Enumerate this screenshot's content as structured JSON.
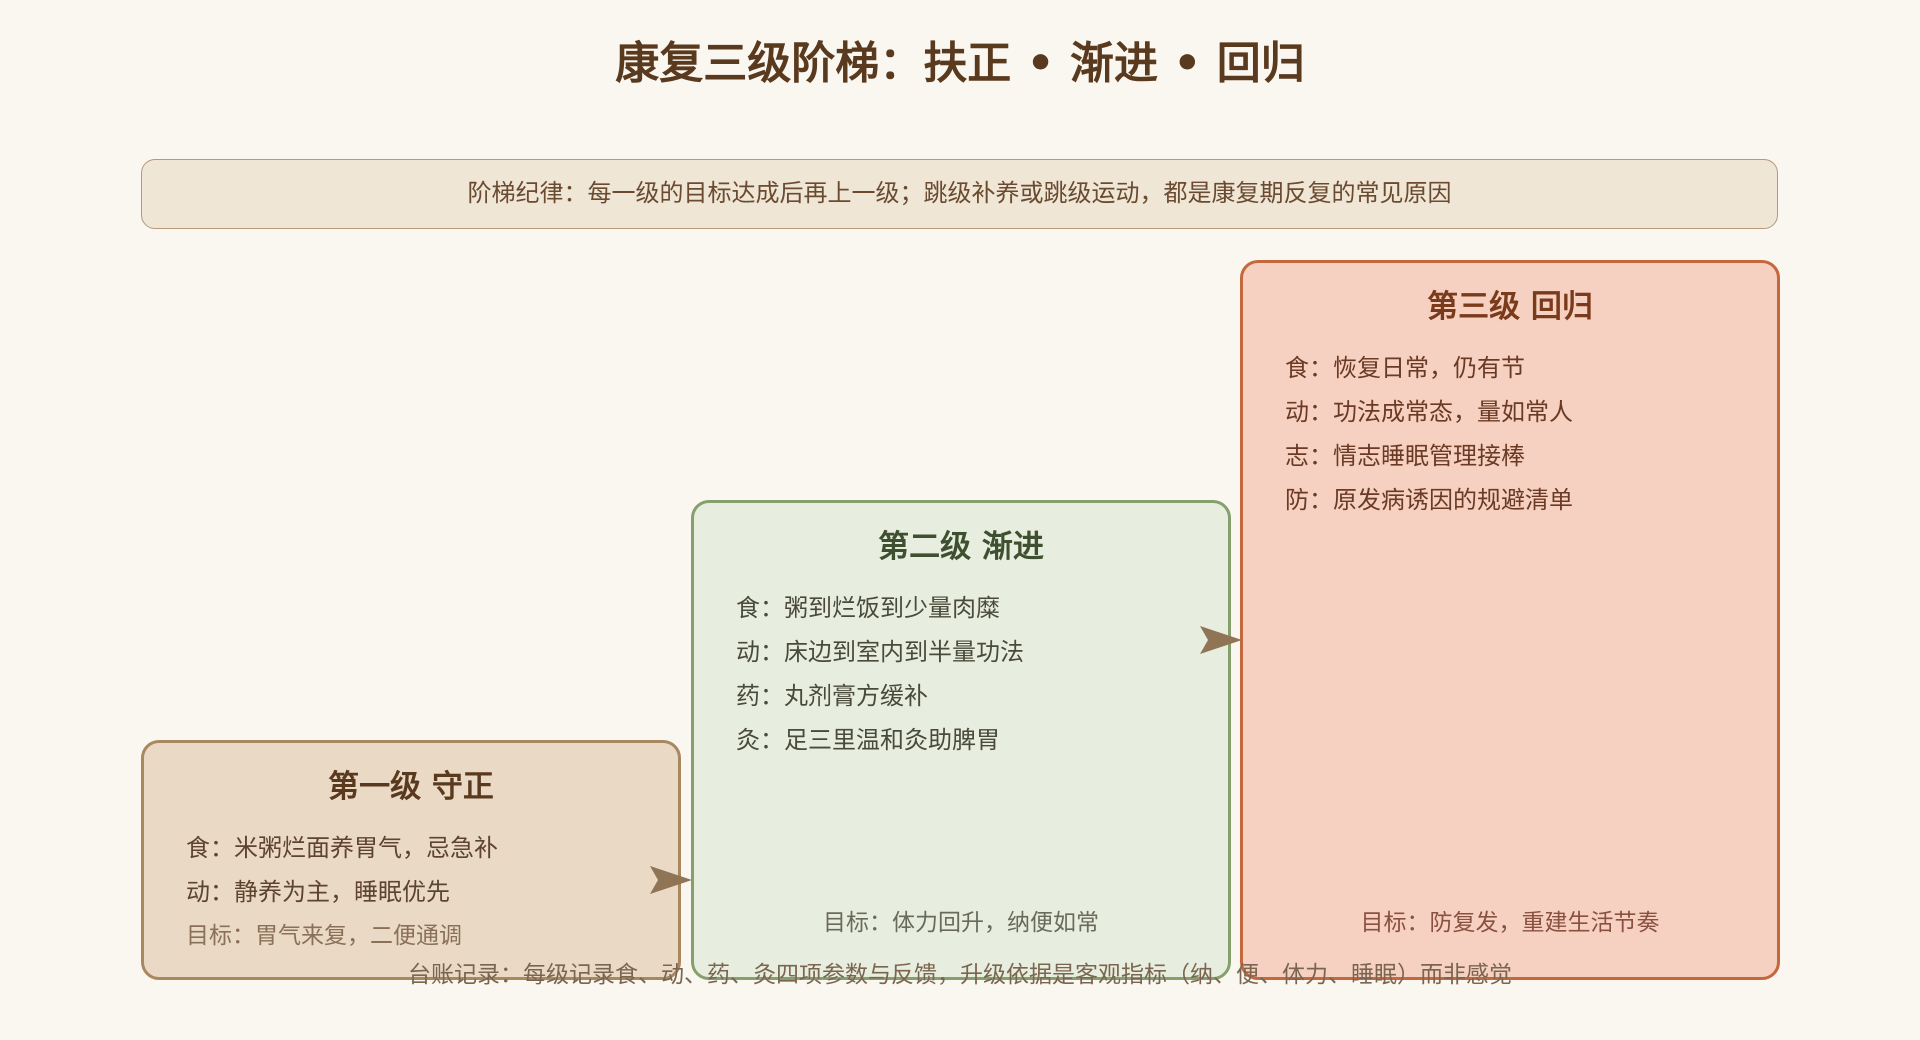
{
  "title": "康复三级阶梯：扶正 • 渐进 • 回归",
  "rule_banner": "阶梯纪律：每一级的目标达成后再上一级；跳级补养或跳级运动，都是康复期反复的常见原因",
  "steps": [
    {
      "title": "第一级 守正",
      "items": [
        "食：米粥烂面养胃气，忌急补",
        "动：静养为主，睡眠优先"
      ],
      "goal": "目标：胃气来复，二便通调",
      "colors": {
        "fill": "#ead9c5",
        "border": "#a98860"
      }
    },
    {
      "title": "第二级 渐进",
      "items": [
        "食：粥到烂饭到少量肉糜",
        "动：床边到室内到半量功法",
        "药：丸剂膏方缓补",
        "灸：足三里温和灸助脾胃"
      ],
      "goal": "目标：体力回升，纳便如常",
      "colors": {
        "fill": "#e8eedf",
        "border": "#85a06c"
      }
    },
    {
      "title": "第三级 回归",
      "items": [
        "食：恢复日常，仍有节",
        "动：功法成常态，量如常人",
        "志：情志睡眠管理接棒",
        "防：原发病诱因的规避清单"
      ],
      "goal": "目标：防复发，重建生活节奏",
      "colors": {
        "fill": "#f6d1c1",
        "border": "#c5683e"
      }
    }
  ],
  "footer": "台账记录：每级记录食、动、药、灸四项参数与反馈，升级依据是客观指标（纳、便、体力、睡眠）而非感觉",
  "colors": {
    "arrow": "#8f7456",
    "title": "#5a3a1e",
    "background": "#faf6f0"
  }
}
